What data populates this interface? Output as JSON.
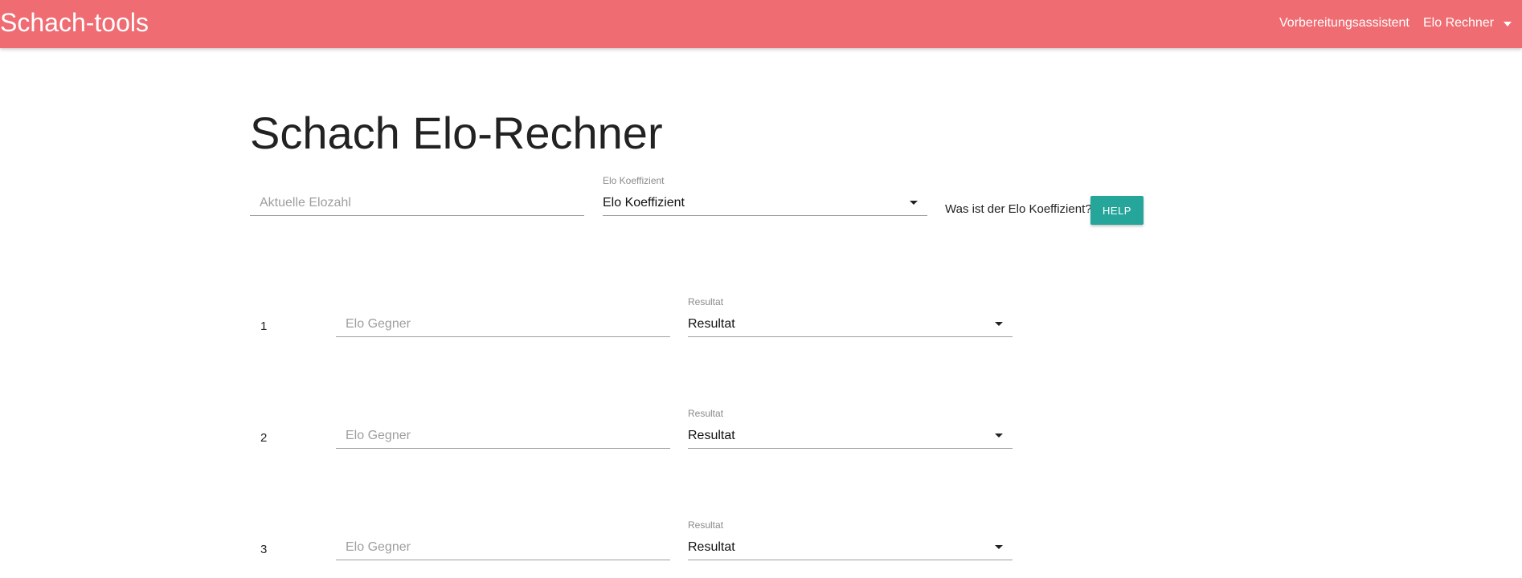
{
  "navbar": {
    "brand": "Schach-tools",
    "links": [
      {
        "label": "Vorbereitungsassistent"
      },
      {
        "label": "Elo Rechner"
      }
    ],
    "color": "#ef6c72"
  },
  "main": {
    "title": "Schach Elo-Rechner",
    "current_elo": {
      "placeholder": "Aktuelle Elozahl",
      "value": ""
    },
    "coefficient": {
      "label": "Elo Koeffizient",
      "selected": "Elo Koeffizient"
    },
    "help": {
      "text": "Was ist der Elo Koeffizient?",
      "button_label": "HELP",
      "button_color": "#26a69a"
    },
    "games": [
      {
        "number": "1",
        "opponent_placeholder": "Elo Gegner",
        "result_label": "Resultat",
        "result_selected": "Resultat"
      },
      {
        "number": "2",
        "opponent_placeholder": "Elo Gegner",
        "result_label": "Resultat",
        "result_selected": "Resultat"
      },
      {
        "number": "3",
        "opponent_placeholder": "Elo Gegner",
        "result_label": "Resultat",
        "result_selected": "Resultat"
      }
    ]
  }
}
